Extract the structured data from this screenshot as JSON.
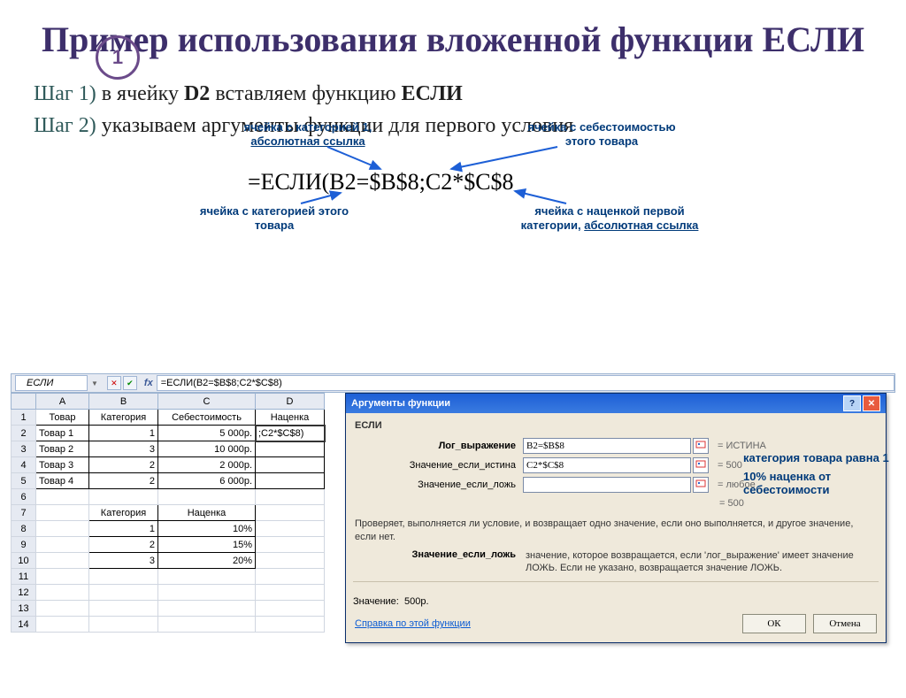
{
  "slide": {
    "badge": "1",
    "title": "Пример использования вложенной функции ЕСЛИ",
    "step1_label": "Шаг 1)",
    "step1_text_a": " в ячейку ",
    "step1_text_b": "D2",
    "step1_text_c": " вставляем функцию ",
    "step1_text_d": "ЕСЛИ",
    "step2_label": "Шаг 2)",
    "step2_text": " указываем аргументы функции для первого условия",
    "formula": "=ЕСЛИ(B2=$B$8;C2*$C$8"
  },
  "annot": {
    "a1_l1": "ячейка с категорией 1,",
    "a1_l2": "абсолютная ссылка",
    "a2_l1": "ячейка с себестоимостью",
    "a2_l2": "этого товара",
    "a3_l1": "ячейка с категорией этого",
    "a3_l2": "товара",
    "a4_l1": "ячейка с наценкой первой",
    "a4_l2": "категории, ",
    "a4_l3": "абсолютная ссылка",
    "side1": "категория товара равна 1",
    "side2": "10% наценка от себестоимости"
  },
  "excel": {
    "namebox": "ЕСЛИ",
    "formula_bar": "=ЕСЛИ(B2=$B$8;C2*$C$8)",
    "cols": [
      "A",
      "B",
      "C",
      "D"
    ],
    "headers": [
      "Товар",
      "Категория",
      "Себестоимость",
      "Наценка"
    ],
    "rows": [
      [
        "Товар 1",
        "1",
        "5 000р.",
        ";C2*$C$8)"
      ],
      [
        "Товар 2",
        "3",
        "10 000р.",
        ""
      ],
      [
        "Товар 3",
        "2",
        "2 000р.",
        ""
      ],
      [
        "Товар 4",
        "2",
        "6 000р.",
        ""
      ]
    ],
    "sub_headers": [
      "Категория",
      "Наценка"
    ],
    "sub_rows": [
      [
        "1",
        "10%"
      ],
      [
        "2",
        "15%"
      ],
      [
        "3",
        "20%"
      ]
    ]
  },
  "dialog": {
    "title": "Аргументы функции",
    "fn": "ЕСЛИ",
    "field1_label": "Лог_выражение",
    "field1_value": "B2=$B$8",
    "field1_result": "= ИСТИНА",
    "field2_label": "Значение_если_истина",
    "field2_value": "C2*$C$8",
    "field2_result": "= 500",
    "field3_label": "Значение_если_ложь",
    "field3_value": "",
    "field3_result": "= любое",
    "overall_result_label": "=",
    "overall_result": "500",
    "desc": "Проверяет, выполняется ли условие, и возвращает одно значение, если оно выполняется, и другое значение, если нет.",
    "desc2_label": "Значение_если_ложь",
    "desc2_text": "значение, которое возвращается, если 'лог_выражение' имеет значение ЛОЖЬ. Если не указано, возвращается значение ЛОЖЬ.",
    "result_label": "Значение:",
    "result_value": "500р.",
    "help": "Справка по этой функции",
    "ok": "ОК",
    "cancel": "Отмена"
  }
}
